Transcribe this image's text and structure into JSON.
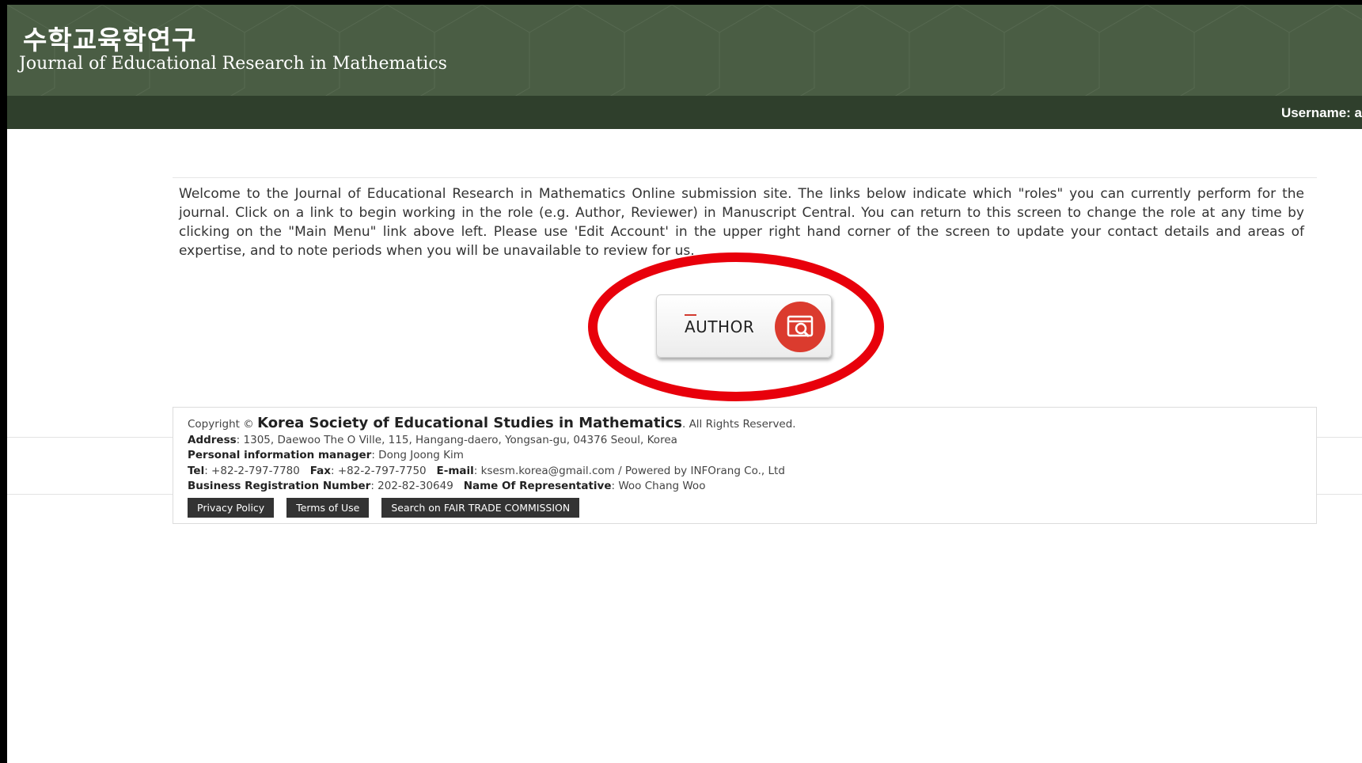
{
  "header": {
    "title_korean": "수학교육학연구",
    "title_english": "Journal of Educational Research in Mathematics",
    "background_color": "#4a5d44"
  },
  "navbar": {
    "username_label": "Username: a",
    "background_color": "#2f3f2c"
  },
  "main": {
    "welcome_text": "Welcome to the Journal of Educational Research in Mathematics Online submission site. The links below indicate which \"roles\" you can currently perform for the journal. Click on a link to begin working in the role (e.g. Author, Reviewer) in Manuscript Central. You can return to this screen to change the role at any time by clicking on the \"Main Menu\" link above left. Please use 'Edit Account' in the upper right hand corner of the screen to update your contact details and areas of expertise, and to note periods when you will be unavailable to review for us.",
    "role_button": {
      "label": "AUTHOR",
      "icon": "document-search-icon",
      "icon_color": "#db3b2e"
    },
    "highlight_color": "#e8000b"
  },
  "footer": {
    "copyright_prefix": "Copyright ©",
    "organization": "Korea Society of Educational Studies in Mathematics",
    "rights": ". All Rights Reserved.",
    "address_label": "Address",
    "address": ": 1305, Daewoo The O Ville, 115, Hangang-daero, Yongsan-gu, 04376 Seoul, Korea",
    "privacy_manager_label": "Personal information manager",
    "privacy_manager": ": Dong Joong Kim",
    "tel_label": "Tel",
    "tel": ": +82-2-797-7780",
    "fax_label": "Fax",
    "fax": ": +82-2-797-7750",
    "email_label": "E-mail",
    "email": ": ksesm.korea@gmail.com / Powered by INFOrang Co., Ltd",
    "brn_label": "Business Registration Number",
    "brn": ": 202-82-30649",
    "representative_label": "Name Of Representative",
    "representative": ": Woo Chang Woo",
    "buttons": [
      {
        "label": "Privacy Policy"
      },
      {
        "label": "Terms of Use"
      },
      {
        "label": "Search on FAIR TRADE COMMISSION"
      }
    ]
  }
}
